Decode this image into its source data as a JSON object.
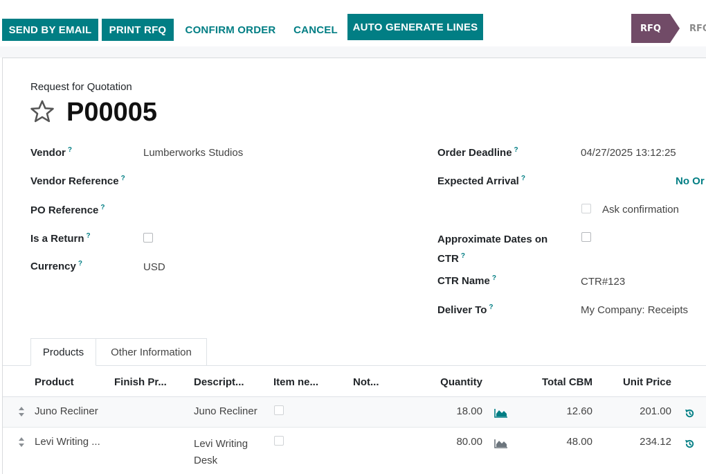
{
  "actions": {
    "send_by_email": "SEND BY EMAIL",
    "print_rfq": "PRINT RFQ",
    "confirm_order": "CONFIRM ORDER",
    "cancel": "CANCEL",
    "auto_generate_lines": "AUTO GENERATE LINES"
  },
  "statusbar": {
    "current": "RFQ",
    "next": "RFQ"
  },
  "form": {
    "subtitle": "Request for Quotation",
    "name": "P00005",
    "left": {
      "vendor_label": "Vendor",
      "vendor_value": "Lumberworks Studios",
      "vendor_ref_label": "Vendor Reference",
      "po_ref_label": "PO Reference",
      "is_return_label": "Is a Return",
      "currency_label": "Currency",
      "currency_value": "USD"
    },
    "right": {
      "order_deadline_label": "Order Deadline",
      "order_deadline_value": "04/27/2025 13:12:25",
      "expected_arrival_label": "Expected Arrival",
      "expected_arrival_value": "No Or",
      "ask_confirmation_label": "Ask confirmation",
      "approx_dates_label_1": "Approximate Dates on",
      "approx_dates_label_2": "CTR",
      "ctr_name_label": "CTR Name",
      "ctr_name_value": "CTR#123",
      "deliver_to_label": "Deliver To",
      "deliver_to_value": "My Company: Receipts"
    },
    "help_mark": "?"
  },
  "tabs": [
    "Products",
    "Other Information"
  ],
  "table": {
    "headers": [
      "Product",
      "Finish Pr...",
      "Descript...",
      "Item ne...",
      "Not...",
      "Quantity",
      "Total CBM",
      "Unit Price"
    ],
    "rows": [
      {
        "product": "Juno Recliner",
        "description": [
          "Juno Recliner"
        ],
        "quantity": "18.00",
        "cbm": "12.60",
        "unit_price": "201.00"
      },
      {
        "product": "Levi Writing ...",
        "description": [
          "Levi Writing",
          "Desk"
        ],
        "quantity": "80.00",
        "cbm": "48.00",
        "unit_price": "234.12"
      }
    ]
  },
  "colors": {
    "primary": "#017e84",
    "status": "#714b67"
  }
}
